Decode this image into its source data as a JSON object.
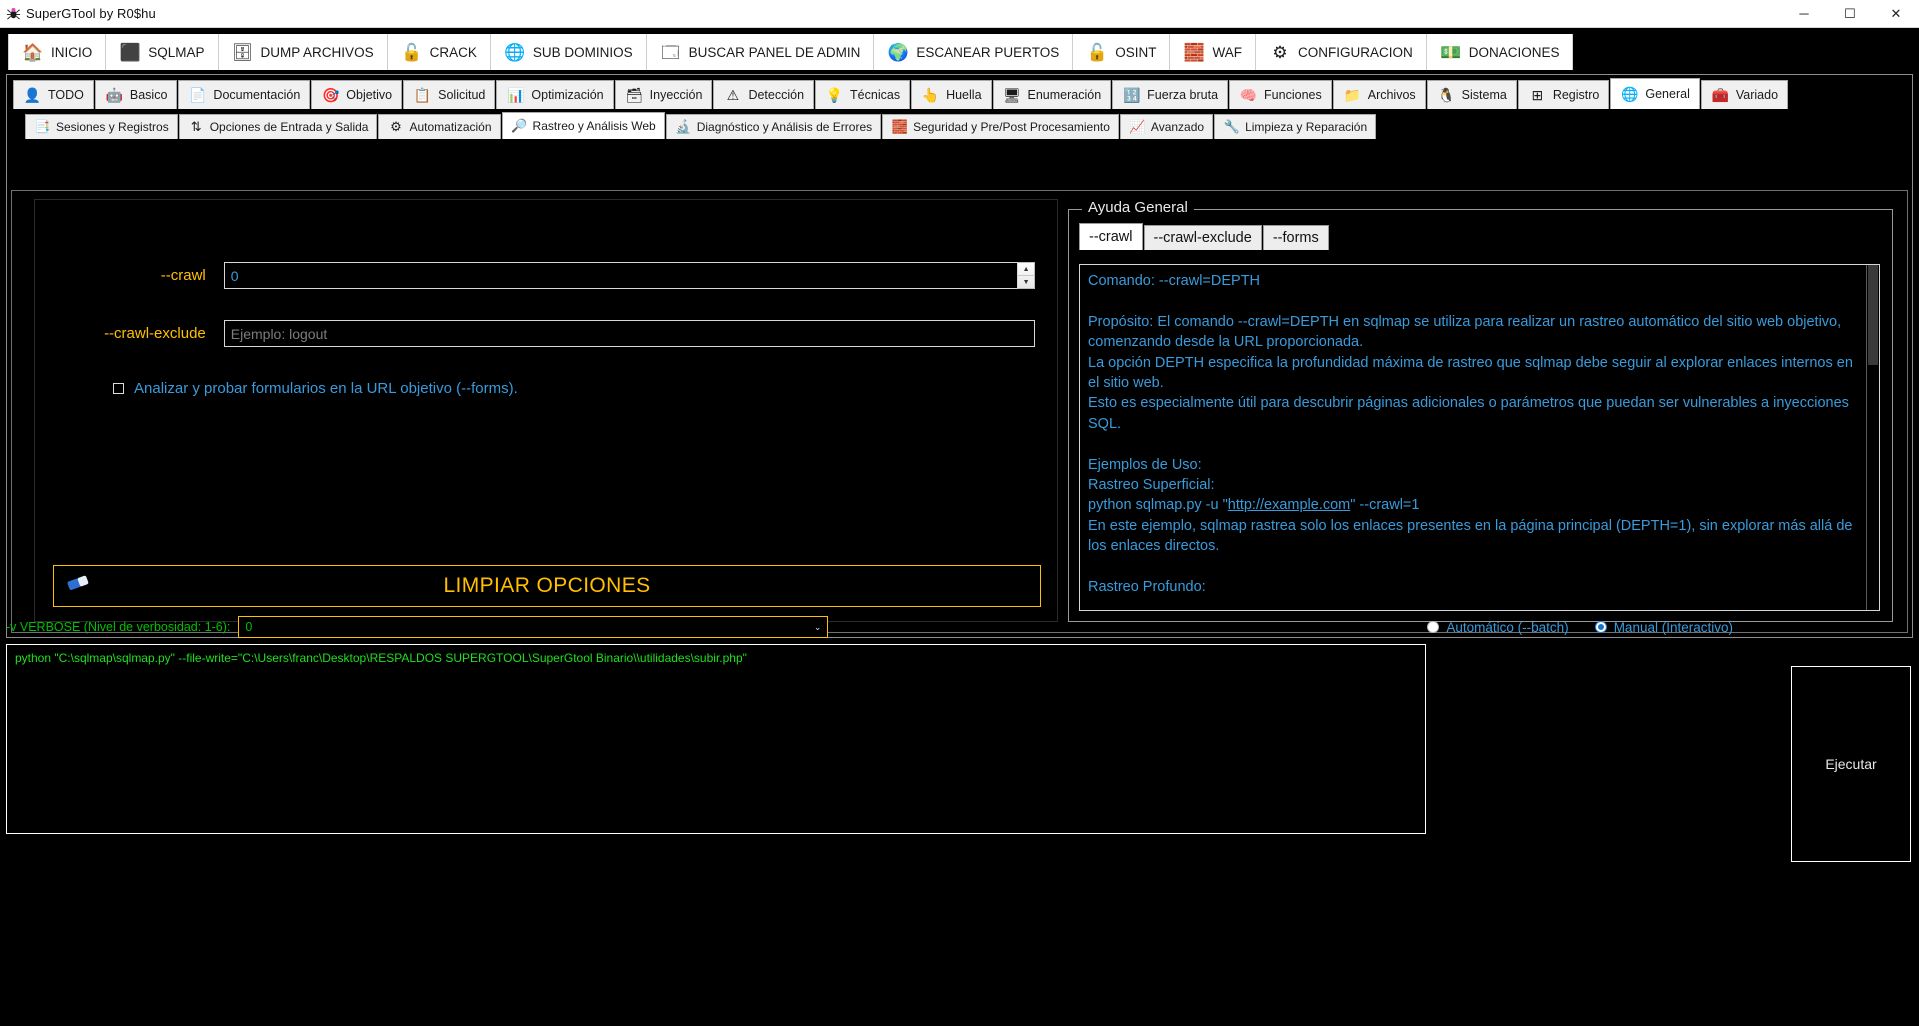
{
  "window": {
    "title": "SuperGTool by R0$hu",
    "app_icon": "spider-icon",
    "minimize": "─",
    "maximize": "☐",
    "close": "✕"
  },
  "ribbon": {
    "items": [
      {
        "label": "INICIO",
        "icon": "home-icon",
        "glyph": "🏠",
        "active": false
      },
      {
        "label": "SQLMAP",
        "icon": "terminal-icon",
        "glyph": "⬛",
        "active": true
      },
      {
        "label": "DUMP ARCHIVOS",
        "icon": "database-download-icon",
        "glyph": "🗄",
        "active": false
      },
      {
        "label": "CRACK",
        "icon": "padlock-crack-icon",
        "glyph": "🔓",
        "active": false
      },
      {
        "label": "SUB DOMINIOS",
        "icon": "globe-network-icon",
        "glyph": "🌐",
        "active": false
      },
      {
        "label": "BUSCAR PANEL DE ADMIN",
        "icon": "admin-panel-icon",
        "glyph": "🗔",
        "active": false
      },
      {
        "label": "ESCANEAR PUERTOS",
        "icon": "port-scan-icon",
        "glyph": "🌍",
        "active": false
      },
      {
        "label": "OSINT",
        "icon": "open-padlock-icon",
        "glyph": "🔓",
        "active": false
      },
      {
        "label": "WAF",
        "icon": "firewall-brick-icon",
        "glyph": "🧱",
        "active": false
      },
      {
        "label": "CONFIGURACION",
        "icon": "gear-icon",
        "glyph": "⚙",
        "active": false
      },
      {
        "label": "DONACIONES",
        "icon": "donate-box-icon",
        "glyph": "💵",
        "active": false
      }
    ]
  },
  "tabs_row1": [
    {
      "label": "TODO",
      "icon": "hacker-icon",
      "glyph": "👤",
      "active": false
    },
    {
      "label": "Basico",
      "icon": "robot-icon",
      "glyph": "🤖",
      "active": false
    },
    {
      "label": "Documentación",
      "icon": "sql-document-icon",
      "glyph": "📄",
      "active": false
    },
    {
      "label": "Objetivo",
      "icon": "target-icon",
      "glyph": "🎯",
      "active": false
    },
    {
      "label": "Solicitud",
      "icon": "request-form-icon",
      "glyph": "📋",
      "active": false
    },
    {
      "label": "Optimización",
      "icon": "speedometer-icon",
      "glyph": "📊",
      "active": false
    },
    {
      "label": "Inyección",
      "icon": "database-inject-icon",
      "glyph": "🗃",
      "active": false
    },
    {
      "label": "Detección",
      "icon": "warning-magnifier-icon",
      "glyph": "⚠",
      "active": false
    },
    {
      "label": "Técnicas",
      "icon": "lightbulb-gear-icon",
      "glyph": "💡",
      "active": false
    },
    {
      "label": "Huella",
      "icon": "fingerprint-icon",
      "glyph": "👆",
      "active": false
    },
    {
      "label": "Enumeración",
      "icon": "server-user-icon",
      "glyph": "🖥",
      "active": false
    },
    {
      "label": "Fuerza bruta",
      "icon": "binary-code-icon",
      "glyph": "🔢",
      "active": false
    },
    {
      "label": "Funciones",
      "icon": "brain-gear-icon",
      "glyph": "🧠",
      "active": false
    },
    {
      "label": "Archivos",
      "icon": "root-file-icon",
      "glyph": "📁",
      "active": false
    },
    {
      "label": "Sistema",
      "icon": "linux-penguin-icon",
      "glyph": "🐧",
      "active": false
    },
    {
      "label": "Registro",
      "icon": "windows-icon",
      "glyph": "⊞",
      "active": false
    },
    {
      "label": "General",
      "icon": "globe-recycle-icon",
      "glyph": "🌐",
      "active": true
    },
    {
      "label": "Variado",
      "icon": "toolbox-icon",
      "glyph": "🧰",
      "active": false
    }
  ],
  "tabs_row2": [
    {
      "label": "Sesiones y Registros",
      "icon": "session-log-icon",
      "glyph": "📑",
      "active": false
    },
    {
      "label": "Opciones de Entrada y Salida",
      "icon": "io-arrows-icon",
      "glyph": "⇅",
      "active": false
    },
    {
      "label": "Automatización",
      "icon": "automation-gear-icon",
      "glyph": "⚙",
      "active": false
    },
    {
      "label": "Rastreo y Análisis Web",
      "icon": "web-crawl-icon",
      "glyph": "🔎",
      "active": true
    },
    {
      "label": "Diagnóstico y Análisis de Errores",
      "icon": "diagnostics-icon",
      "glyph": "🔬",
      "active": false
    },
    {
      "label": "Seguridad y Pre/Post Procesamiento",
      "icon": "security-wall-icon",
      "glyph": "🧱",
      "active": false
    },
    {
      "label": "Avanzado",
      "icon": "advanced-chart-icon",
      "glyph": "📈",
      "active": false
    },
    {
      "label": "Limpieza y Reparación",
      "icon": "tools-icon",
      "glyph": "🔧",
      "active": false
    }
  ],
  "form": {
    "crawl": {
      "label": "--crawl",
      "value": "0",
      "spin_up": "▲",
      "spin_down": "▼"
    },
    "crawl_exclude": {
      "label": "--crawl-exclude",
      "value": "",
      "placeholder": "Ejemplo: logout"
    },
    "forms_checkbox": {
      "label": "Analizar y probar formularios en la URL objetivo (--forms).",
      "checked": false
    },
    "clear_button": {
      "label": "LIMPIAR OPCIONES",
      "icon": "eraser-icon",
      "glyph": "🧽",
      "color": "#ffc000"
    }
  },
  "help": {
    "group_title": "Ayuda General",
    "tabs": [
      {
        "label": "--crawl",
        "active": true
      },
      {
        "label": "--crawl-exclude",
        "active": false
      },
      {
        "label": "--forms",
        "active": false
      }
    ],
    "body_before_link": "Comando: --crawl=DEPTH\n\nPropósito: El comando --crawl=DEPTH en sqlmap se utiliza para realizar un rastreo automático del sitio web objetivo, comenzando desde la URL proporcionada.\nLa opción DEPTH especifica la profundidad máxima de rastreo que sqlmap debe seguir al explorar enlaces internos en el sitio web.\nEsto es especialmente útil para descubrir páginas adicionales o parámetros que puedan ser vulnerables a inyecciones SQL.\n\nEjemplos de Uso:\nRastreo Superficial:\npython sqlmap.py -u \"",
    "link_text": "http://example.com",
    "body_after_link": "\" --crawl=1\nEn este ejemplo, sqlmap rastrea solo los enlaces presentes en la página principal (DEPTH=1), sin explorar más allá de los enlaces directos.\n\nRastreo Profundo:"
  },
  "bottom": {
    "verbose_label": "-v VERBOSE (Nivel de verbosidad: 1-6):",
    "verbose_value": "0",
    "verbose_arrow": "⌄",
    "mode_auto": "Automático (--batch)",
    "mode_manual": "Manual (Interactivo)",
    "mode_selected": "manual",
    "command": "python \"C:\\sqlmap\\sqlmap.py\" --file-write=\"C:\\Users\\franc\\Desktop\\RESPALDOS SUPERGTOOL\\SuperGtool Binario\\\\utilidades\\subir.php\"",
    "execute_label": "Ejecutar"
  },
  "colors": {
    "accent_yellow": "#ffc000",
    "link_blue": "#3a9bdc",
    "command_green": "#1ee01e",
    "background": "#000000"
  }
}
